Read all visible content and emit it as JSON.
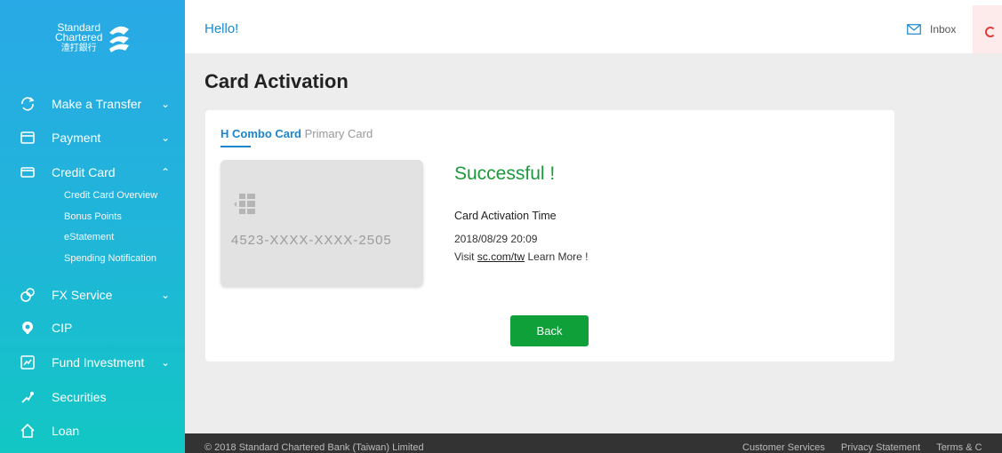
{
  "brand": {
    "line1": "Standard",
    "line2": "Chartered",
    "line3": "渣打銀行"
  },
  "sidebar": {
    "items": [
      {
        "label": "Make a Transfer",
        "chevron": "⌄"
      },
      {
        "label": "Payment",
        "chevron": "⌄"
      },
      {
        "label": "Credit Card",
        "chevron": "⌃"
      },
      {
        "label": "FX Service",
        "chevron": "⌄"
      },
      {
        "label": "CIP"
      },
      {
        "label": "Fund Investment",
        "chevron": "⌄"
      },
      {
        "label": "Securities"
      },
      {
        "label": "Loan"
      }
    ],
    "subitems": [
      "Credit Card Overview",
      "Bonus Points",
      "eStatement",
      "Spending Notification"
    ]
  },
  "header": {
    "greeting": "Hello!",
    "inbox": "Inbox"
  },
  "main": {
    "title": "Card Activation",
    "tab_main": "H Combo Card",
    "tab_sub": "Primary Card",
    "card_number": "4523-XXXX-XXXX-2505",
    "status": "Successful !",
    "activation_label": "Card Activation Time",
    "activation_time": "2018/08/29 20:09",
    "visit_prefix": "Visit ",
    "visit_link": "sc.com/tw",
    "visit_suffix": " Learn More !",
    "back_label": "Back"
  },
  "footer": {
    "copyright": "© 2018 Standard Chartered Bank (Taiwan) Limited",
    "links": [
      "Customer Services",
      "Privacy Statement",
      "Terms & C"
    ]
  },
  "colors": {
    "accent": "#1b86cc",
    "success": "#1a9a3a",
    "button": "#0fa03a",
    "footer": "#333333"
  }
}
